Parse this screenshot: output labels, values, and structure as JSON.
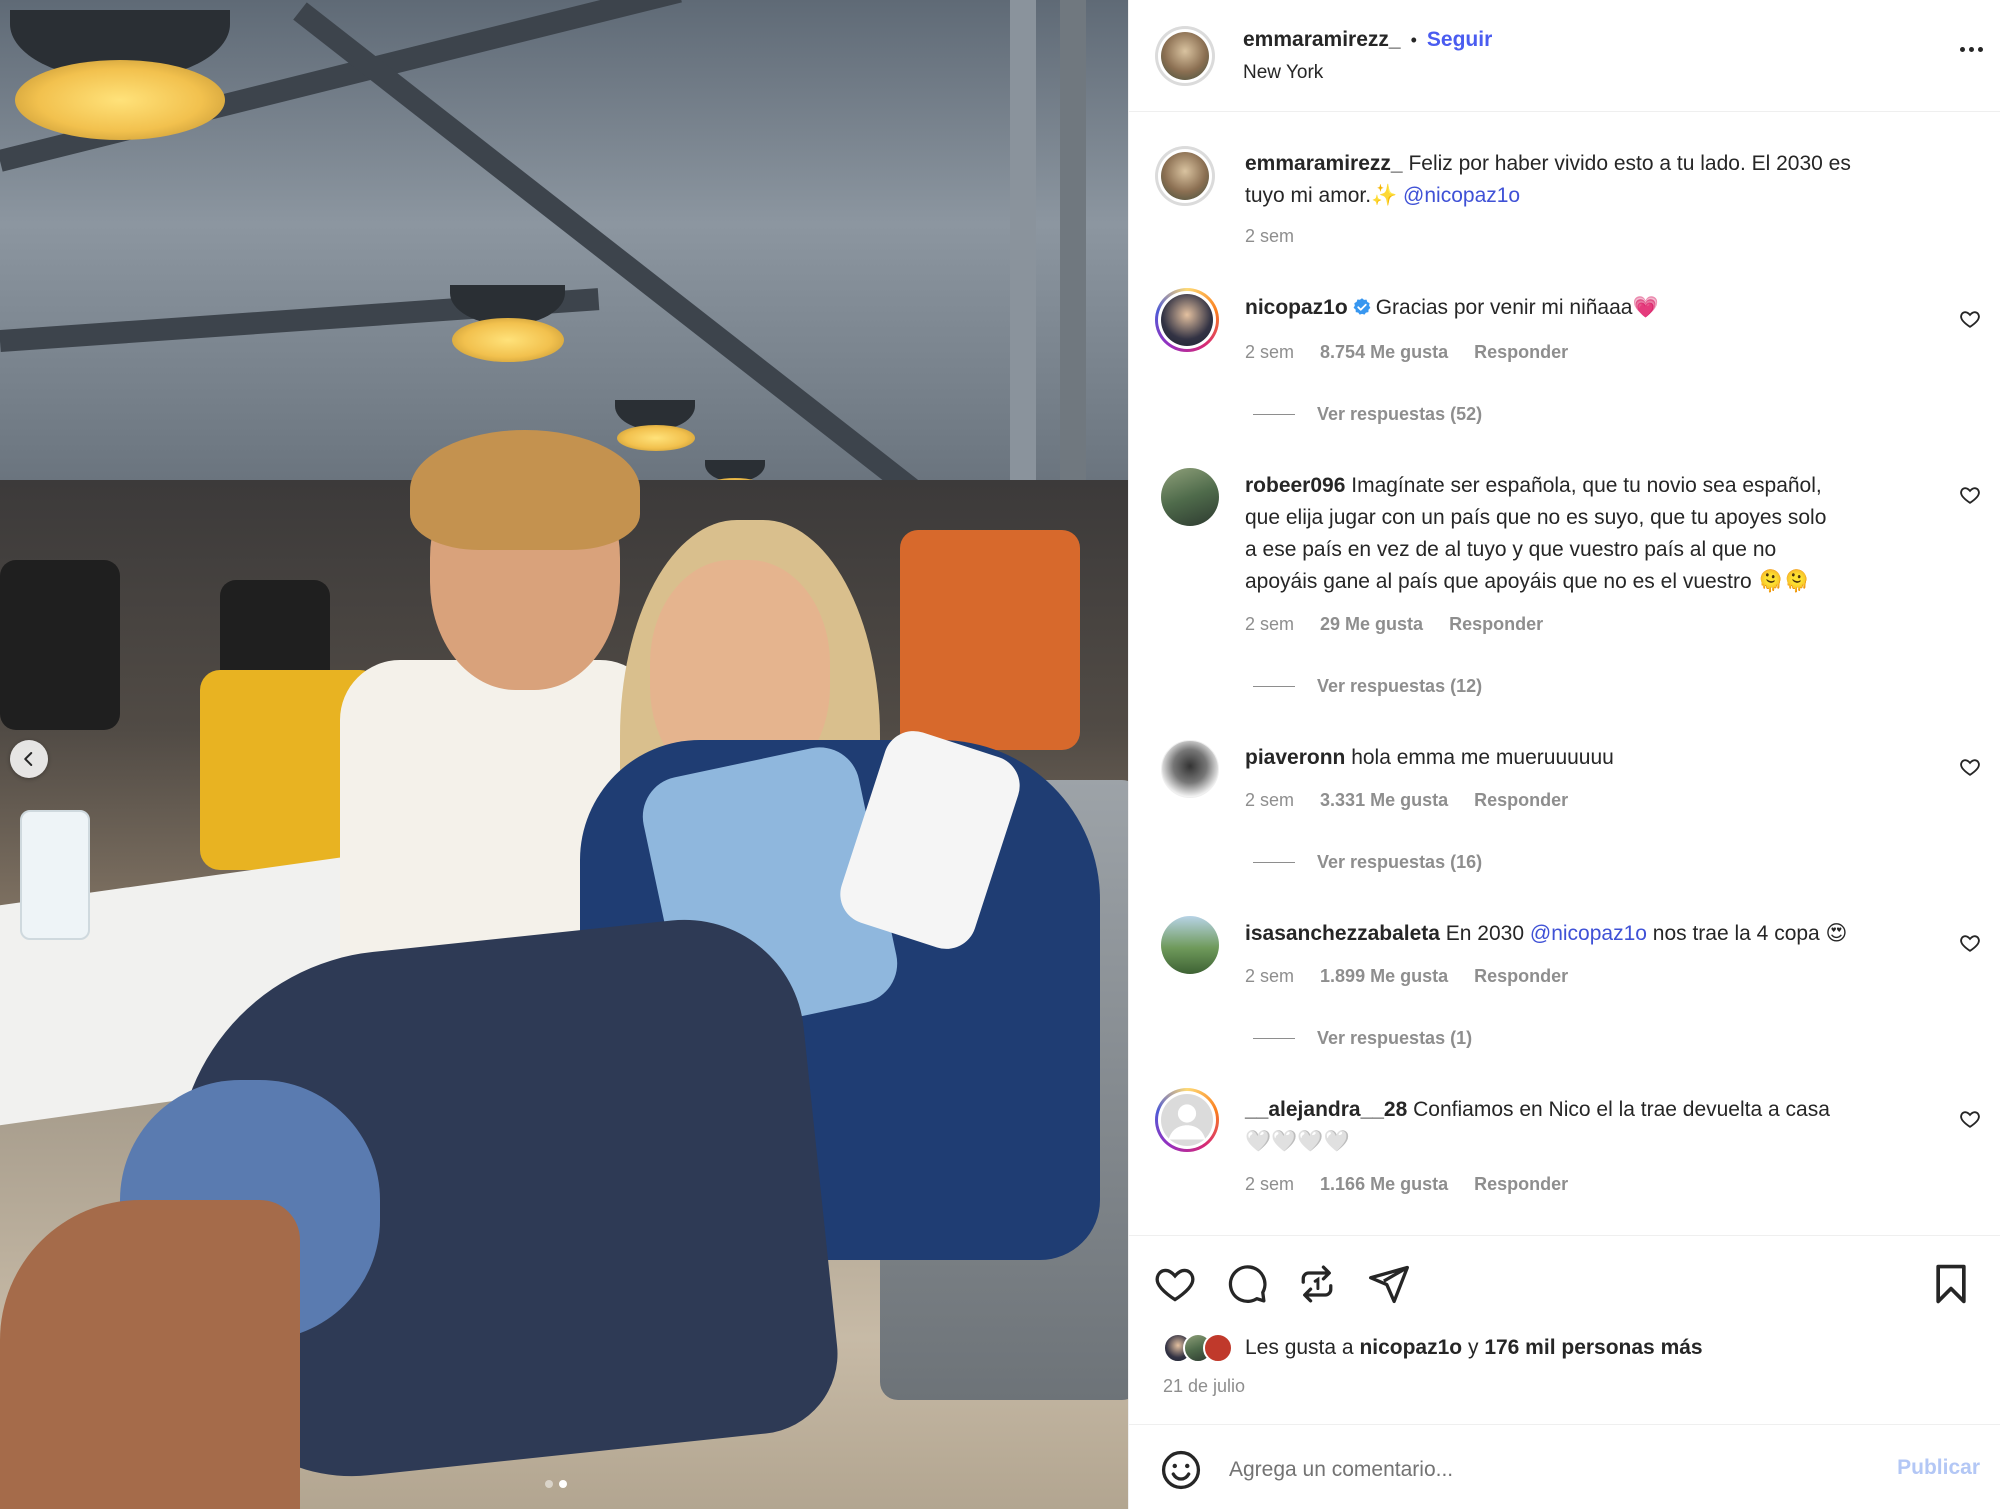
{
  "post": {
    "author": "emmaramirezz_",
    "separator": "•",
    "follow_label": "Seguir",
    "location": "New York",
    "caption_text": "Feliz por haber vivido esto a tu lado. El 2030 es",
    "caption_text_2": "tuyo mi amor.✨",
    "caption_mention": "@nicopaz1o",
    "caption_time": "2 sem"
  },
  "comments": [
    {
      "user": "nicopaz1o",
      "verified": true,
      "text": "Gracias por venir mi niñaaa💗",
      "time": "2 sem",
      "likes": "8.754 Me gusta",
      "reply": "Responder",
      "view_replies": "Ver respuestas (52)"
    },
    {
      "user": "robeer096",
      "text_1": "Imagínate ser española, que tu novio sea español,",
      "text_2": "que elija jugar con un país que no es suyo, que tu apoyes solo",
      "text_3": "a ese país en vez de al tuyo y que vuestro país al que no",
      "text_4": "apoyáis gane al país que apoyáis que no es el vuestro 🫠🫠",
      "time": "2 sem",
      "likes": "29 Me gusta",
      "reply": "Responder",
      "view_replies": "Ver respuestas (12)"
    },
    {
      "user": "piaveronn",
      "text": "hola emma me mueruuuuuu",
      "time": "2 sem",
      "likes": "3.331 Me gusta",
      "reply": "Responder",
      "view_replies": "Ver respuestas (16)"
    },
    {
      "user": "isasanchezzabaleta",
      "text_before": "En 2030",
      "mention": "@nicopaz1o",
      "text_after": "nos trae la 4 copa 😍",
      "time": "2 sem",
      "likes": "1.899 Me gusta",
      "reply": "Responder",
      "view_replies": "Ver respuestas (1)"
    },
    {
      "user": "__alejandra__28",
      "text_1": "Confiamos en Nico el la trae devuelta a casa",
      "text_2": "🤍🤍🤍🤍",
      "time": "2 sem",
      "likes": "1.166 Me gusta",
      "reply": "Responder"
    }
  ],
  "likes": {
    "prefix": "Les gusta a",
    "user": "nicopaz1o",
    "connector": "y",
    "others": "176 mil personas más",
    "date": "21 de julio"
  },
  "comment_box": {
    "placeholder": "Agrega un comentario...",
    "submit_label": "Publicar"
  },
  "icons": [
    "more-icon",
    "heart-icon",
    "comment-icon",
    "repost-icon",
    "share-icon",
    "bookmark-icon",
    "emoji-icon",
    "verified-icon",
    "chevron-left-icon"
  ],
  "colors": {
    "link": "#3f51d6",
    "follow": "#4a5cf0",
    "publish_disabled": "#b3c7f5",
    "muted": "#8e8e8e"
  },
  "carousel": {
    "slides": 2,
    "active": 2
  }
}
